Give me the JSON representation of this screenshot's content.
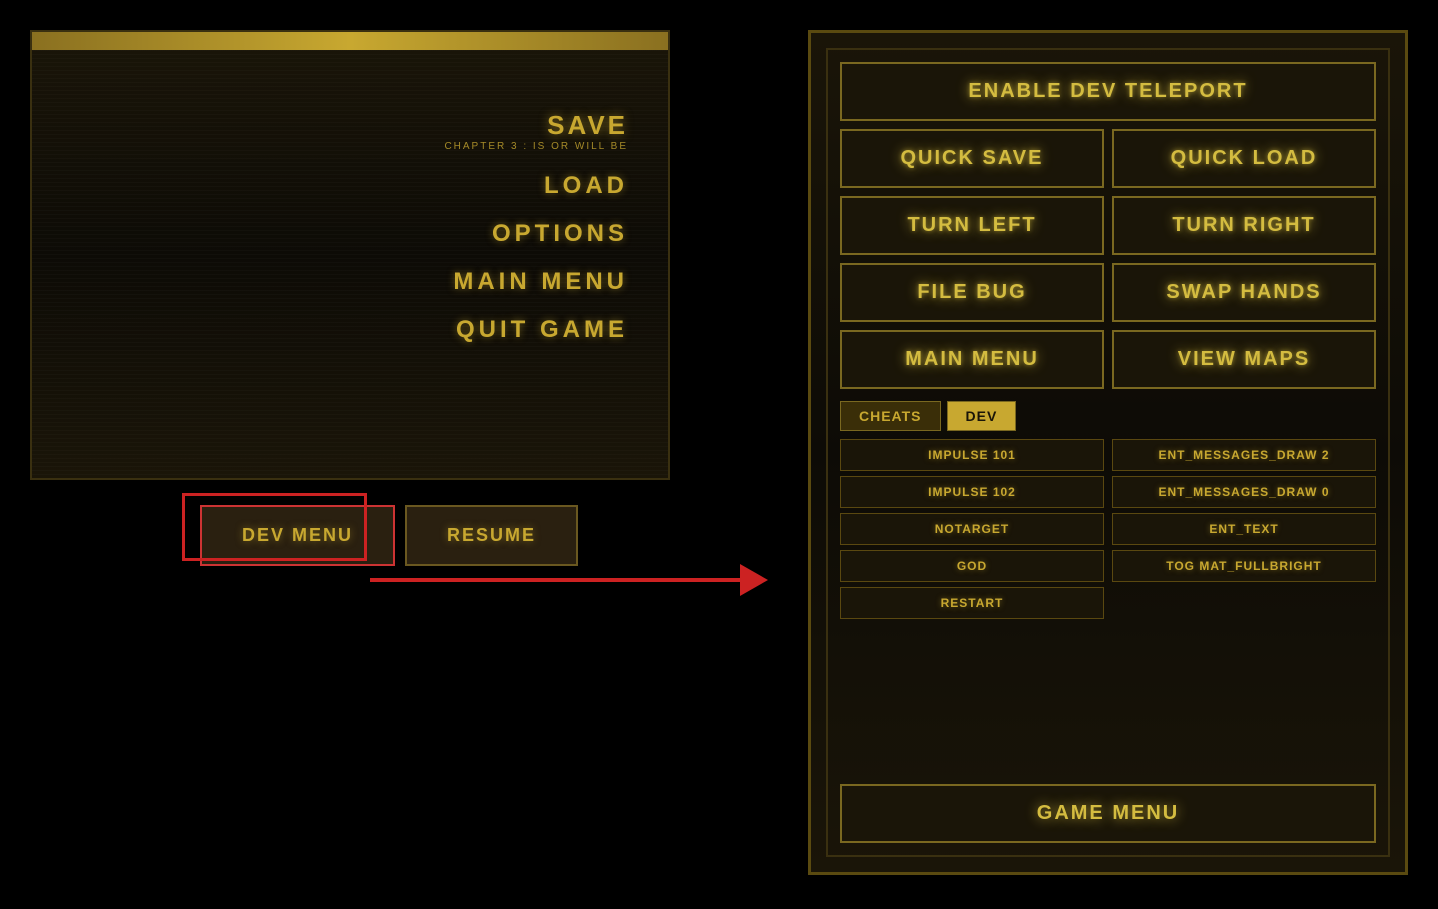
{
  "left_panel": {
    "menu": {
      "save_label": "SAVE",
      "save_subtitle": "CHAPTER 3 : IS OR WILL BE",
      "items": [
        "LOAD",
        "OPTIONS",
        "MAIN MENU",
        "QUIT GAME"
      ]
    }
  },
  "bottom_buttons": {
    "dev_menu": "DEV MENU",
    "resume": "RESUME"
  },
  "right_panel": {
    "enable_dev_teleport": "ENABLE DEV TELEPORT",
    "quick_save": "QUICK SAVE",
    "quick_load": "QUICK LOAD",
    "turn_left": "TURN LEFT",
    "turn_right": "TURN RIGHT",
    "file_bug": "FILE BUG",
    "swap_hands": "SWAP HANDS",
    "main_menu": "MAIN MENU",
    "view_maps": "VIEW MAPS",
    "tabs": [
      "CHEATS",
      "DEV"
    ],
    "active_tab": "DEV",
    "cheats_col": [
      "IMPULSE 101",
      "IMPULSE 102",
      "NOTARGET",
      "GOD",
      "RESTART"
    ],
    "dev_col": [
      "ENT_MESSAGES_DRAW 2",
      "ENT_MESSAGES_DRAW 0",
      "ENT_TEXT",
      "TOG MAT_FULLBRIGHT"
    ],
    "game_menu": "GAME MENU"
  }
}
